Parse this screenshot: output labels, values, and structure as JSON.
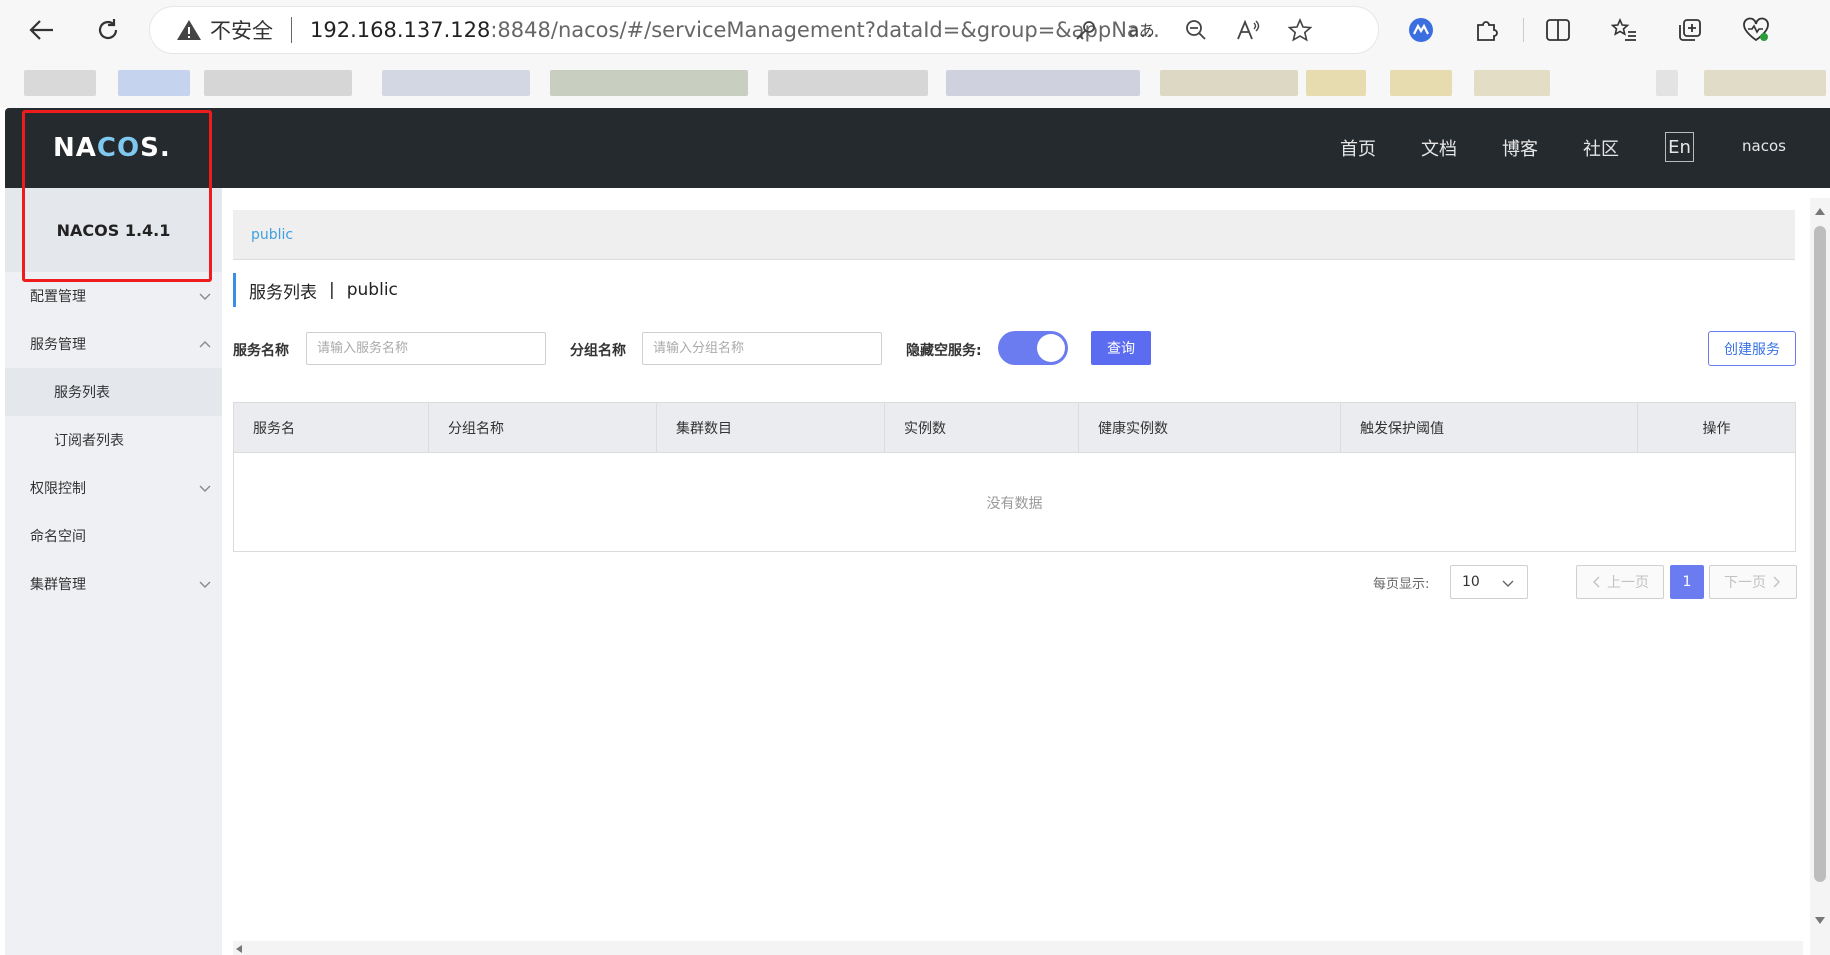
{
  "browser": {
    "address": {
      "insecure_label": "不安全",
      "url_host": "192.168.137.128",
      "url_rest": ":8848/nacos/#/serviceManagement?dataId=&group=&appNa..."
    },
    "bookmark_colors": [
      "#c8d8b8",
      "#d9d9d9",
      "#a8c0f0",
      "#d6d6d6",
      "#c9d2e8",
      "#8fb060",
      "#d6d6d6",
      "#b8bcd8",
      "#e8d890",
      "#e8d890"
    ]
  },
  "header": {
    "logo_text": "NACOS.",
    "nav": {
      "home": "首页",
      "docs": "文档",
      "blog": "博客",
      "community": "社区"
    },
    "lang": "En",
    "user": "nacos"
  },
  "sidebar": {
    "version": "NACOS 1.4.1",
    "items": [
      {
        "label": "配置管理"
      },
      {
        "label": "服务管理"
      },
      {
        "label": "服务列表"
      },
      {
        "label": "订阅者列表"
      },
      {
        "label": "权限控制"
      },
      {
        "label": "命名空间"
      },
      {
        "label": "集群管理"
      }
    ]
  },
  "main": {
    "breadcrumb": "public",
    "title": "服务列表",
    "title_sep": "|",
    "namespace": "public",
    "search": {
      "service_name_label": "服务名称",
      "service_name_placeholder": "请输入服务名称",
      "group_name_label": "分组名称",
      "group_name_placeholder": "请输入分组名称",
      "hide_empty_label": "隐藏空服务:",
      "hide_empty_on": true,
      "query_label": "查询",
      "create_label": "创建服务"
    },
    "table": {
      "columns": [
        "服务名",
        "分组名称",
        "集群数目",
        "实例数",
        "健康实例数",
        "触发保护阈值",
        "操作"
      ],
      "empty_text": "没有数据"
    },
    "pagination": {
      "per_page_label": "每页显示:",
      "per_page_value": "10",
      "prev_label": "上一页",
      "current_page": "1",
      "next_label": "下一页"
    }
  },
  "colors": {
    "header_bg": "#252a2f",
    "accent": "#6b7cf0",
    "highlight": "#ee1c1c"
  }
}
